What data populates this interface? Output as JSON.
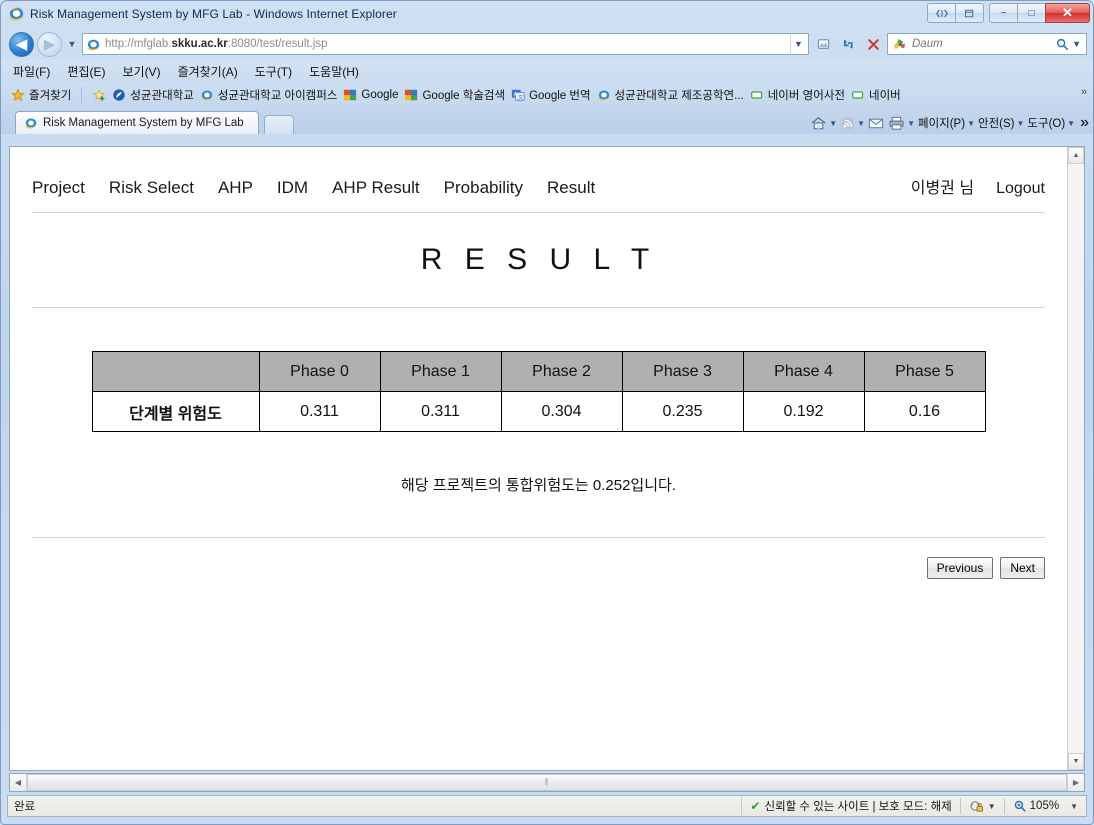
{
  "window": {
    "title": "Risk Management System by MFG Lab - Windows Internet Explorer",
    "controls": {
      "compat": "compat-view-icon",
      "restore_group": "restore-group-icon",
      "minimize": "−",
      "maximize": "□",
      "close": "✕"
    }
  },
  "navbar": {
    "back": "◀",
    "forward": "▶",
    "history_caret": "▼",
    "url_prefix": "http://mfglab.",
    "url_bold": "skku.ac.kr",
    "url_suffix": ":8080/test/result.jsp",
    "url_full": "http://mfglab.skku.ac.kr:8080/test/result.jsp",
    "address_caret": "▼",
    "compat_button": "compatibility-icon",
    "refresh_button": "refresh-icon",
    "stop_button": "✕",
    "search_engine": "Daum",
    "search_placeholder": "Daum",
    "search_caret": "▼"
  },
  "menubar": [
    {
      "label": "파일(F)",
      "name": "menu-file"
    },
    {
      "label": "편집(E)",
      "name": "menu-edit"
    },
    {
      "label": "보기(V)",
      "name": "menu-view"
    },
    {
      "label": "즐겨찾기(A)",
      "name": "menu-favorites"
    },
    {
      "label": "도구(T)",
      "name": "menu-tools"
    },
    {
      "label": "도움말(H)",
      "name": "menu-help"
    }
  ],
  "favorites": {
    "bar_label": "즐겨찾기",
    "items": [
      {
        "label": "성균관대학교",
        "icon": "skku-icon"
      },
      {
        "label": "성균관대학교 아이캠퍼스",
        "icon": "ie-icon"
      },
      {
        "label": "Google",
        "icon": "google-icon"
      },
      {
        "label": "Google 학술검색",
        "icon": "google-icon"
      },
      {
        "label": "Google 번역",
        "icon": "translate-icon"
      },
      {
        "label": "성균관대학교 제조공학연...",
        "icon": "ie-icon"
      },
      {
        "label": "네이버 영어사전",
        "icon": "naver-icon"
      },
      {
        "label": "네이버",
        "icon": "naver-icon"
      }
    ],
    "overflow": "»"
  },
  "tabs": {
    "active": "Risk Management System by MFG Lab",
    "new_tab": "new-tab-button",
    "tools": [
      {
        "label": "",
        "name": "home-button",
        "icon": "home-icon",
        "caret": "▼"
      },
      {
        "label": "",
        "name": "feeds-button",
        "icon": "rss-icon",
        "caret": "▼"
      },
      {
        "label": "",
        "name": "mail-button",
        "icon": "mail-icon",
        "caret": ""
      },
      {
        "label": "",
        "name": "print-button",
        "icon": "printer-icon",
        "caret": "▼"
      },
      {
        "label": "페이지(P)",
        "name": "page-menu-button",
        "icon": "",
        "caret": "▼"
      },
      {
        "label": "안전(S)",
        "name": "safety-menu-button",
        "icon": "",
        "caret": "▼"
      },
      {
        "label": "도구(O)",
        "name": "tools-menu-button",
        "icon": "",
        "caret": "▼"
      }
    ],
    "overflow": "»"
  },
  "site": {
    "nav": [
      {
        "label": "Project",
        "name": "nav-project"
      },
      {
        "label": "Risk Select",
        "name": "nav-risk-select"
      },
      {
        "label": "AHP",
        "name": "nav-ahp"
      },
      {
        "label": "IDM",
        "name": "nav-idm"
      },
      {
        "label": "AHP Result",
        "name": "nav-ahp-result"
      },
      {
        "label": "Probability",
        "name": "nav-probability"
      },
      {
        "label": "Result",
        "name": "nav-result"
      }
    ],
    "user": "이병권 님",
    "logout": "Logout",
    "title": "R E S U L T",
    "summary": "해당 프로젝트의 통합위험도는 0.252입니다.",
    "buttons": {
      "previous": "Previous",
      "next": "Next"
    }
  },
  "chart_data": {
    "type": "table",
    "title": "R E S U L T",
    "corner_header": "",
    "categories": [
      "Phase 0",
      "Phase 1",
      "Phase 2",
      "Phase 3",
      "Phase 4",
      "Phase 5"
    ],
    "row_label": "단계별 위험도",
    "values": [
      0.311,
      0.311,
      0.304,
      0.235,
      0.192,
      0.16
    ],
    "values_text": [
      "0.311",
      "0.311",
      "0.304",
      "0.235",
      "0.192",
      "0.16"
    ],
    "integrated_risk": 0.252,
    "xlabel": "Phase",
    "ylabel": "단계별 위험도"
  },
  "scrollbars": {
    "v_up": "▲",
    "v_down": "▼",
    "h_left": "◀",
    "h_right": "▶",
    "h_grip": "⦀"
  },
  "statusbar": {
    "left": "완료",
    "zone": "신뢰할 수 있는 사이트 | 보호 모드: 해제",
    "zone_check": "✔",
    "zone_caret": "▼",
    "zoom": "105%",
    "zoom_caret": "▼"
  }
}
